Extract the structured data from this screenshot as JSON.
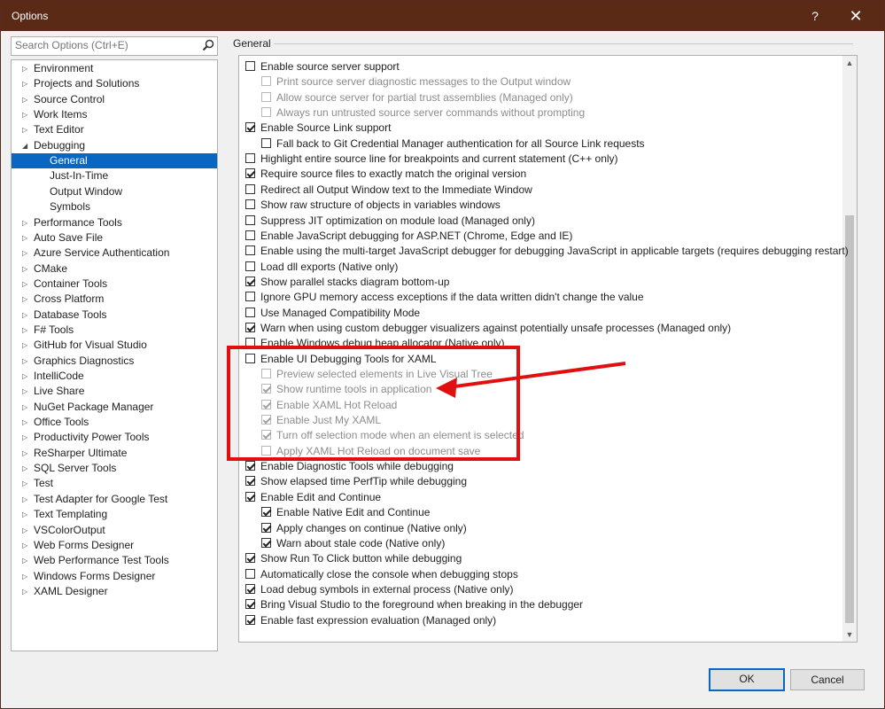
{
  "window": {
    "title": "Options",
    "help_button": "?",
    "close_button": "✕"
  },
  "search": {
    "placeholder": "Search Options (Ctrl+E)"
  },
  "tree": {
    "items": [
      {
        "label": "Environment",
        "level": 0,
        "expanded": false
      },
      {
        "label": "Projects and Solutions",
        "level": 0,
        "expanded": false
      },
      {
        "label": "Source Control",
        "level": 0,
        "expanded": false
      },
      {
        "label": "Work Items",
        "level": 0,
        "expanded": false
      },
      {
        "label": "Text Editor",
        "level": 0,
        "expanded": false
      },
      {
        "label": "Debugging",
        "level": 0,
        "expanded": true
      },
      {
        "label": "General",
        "level": 1,
        "selected": true
      },
      {
        "label": "Just-In-Time",
        "level": 1
      },
      {
        "label": "Output Window",
        "level": 1
      },
      {
        "label": "Symbols",
        "level": 1
      },
      {
        "label": "Performance Tools",
        "level": 0,
        "expanded": false
      },
      {
        "label": "Auto Save File",
        "level": 0,
        "expanded": false
      },
      {
        "label": "Azure Service Authentication",
        "level": 0,
        "expanded": false
      },
      {
        "label": "CMake",
        "level": 0,
        "expanded": false
      },
      {
        "label": "Container Tools",
        "level": 0,
        "expanded": false
      },
      {
        "label": "Cross Platform",
        "level": 0,
        "expanded": false
      },
      {
        "label": "Database Tools",
        "level": 0,
        "expanded": false
      },
      {
        "label": "F# Tools",
        "level": 0,
        "expanded": false
      },
      {
        "label": "GitHub for Visual Studio",
        "level": 0,
        "expanded": false
      },
      {
        "label": "Graphics Diagnostics",
        "level": 0,
        "expanded": false
      },
      {
        "label": "IntelliCode",
        "level": 0,
        "expanded": false
      },
      {
        "label": "Live Share",
        "level": 0,
        "expanded": false
      },
      {
        "label": "NuGet Package Manager",
        "level": 0,
        "expanded": false
      },
      {
        "label": "Office Tools",
        "level": 0,
        "expanded": false
      },
      {
        "label": "Productivity Power Tools",
        "level": 0,
        "expanded": false
      },
      {
        "label": "ReSharper Ultimate",
        "level": 0,
        "expanded": false
      },
      {
        "label": "SQL Server Tools",
        "level": 0,
        "expanded": false
      },
      {
        "label": "Test",
        "level": 0,
        "expanded": false
      },
      {
        "label": "Test Adapter for Google Test",
        "level": 0,
        "expanded": false
      },
      {
        "label": "Text Templating",
        "level": 0,
        "expanded": false
      },
      {
        "label": "VSColorOutput",
        "level": 0,
        "expanded": false
      },
      {
        "label": "Web Forms Designer",
        "level": 0,
        "expanded": false
      },
      {
        "label": "Web Performance Test Tools",
        "level": 0,
        "expanded": false
      },
      {
        "label": "Windows Forms Designer",
        "level": 0,
        "expanded": false
      },
      {
        "label": "XAML Designer",
        "level": 0,
        "expanded": false
      }
    ]
  },
  "section": {
    "title": "General"
  },
  "options": [
    {
      "label": "Enable source server support",
      "indent": 0,
      "checked": false,
      "enabled": true
    },
    {
      "label": "Print source server diagnostic messages to the Output window",
      "indent": 1,
      "checked": false,
      "enabled": false
    },
    {
      "label": "Allow source server for partial trust assemblies (Managed only)",
      "indent": 1,
      "checked": false,
      "enabled": false
    },
    {
      "label": "Always run untrusted source server commands without prompting",
      "indent": 1,
      "checked": false,
      "enabled": false
    },
    {
      "label": "Enable Source Link support",
      "indent": 0,
      "checked": true,
      "enabled": true
    },
    {
      "label": "Fall back to Git Credential Manager authentication for all Source Link requests",
      "indent": 1,
      "checked": false,
      "enabled": true
    },
    {
      "label": "Highlight entire source line for breakpoints and current statement (C++ only)",
      "indent": 0,
      "checked": false,
      "enabled": true
    },
    {
      "label": "Require source files to exactly match the original version",
      "indent": 0,
      "checked": true,
      "enabled": true
    },
    {
      "label": "Redirect all Output Window text to the Immediate Window",
      "indent": 0,
      "checked": false,
      "enabled": true
    },
    {
      "label": "Show raw structure of objects in variables windows",
      "indent": 0,
      "checked": false,
      "enabled": true
    },
    {
      "label": "Suppress JIT optimization on module load (Managed only)",
      "indent": 0,
      "checked": false,
      "enabled": true
    },
    {
      "label": "Enable JavaScript debugging for ASP.NET (Chrome, Edge and IE)",
      "indent": 0,
      "checked": false,
      "enabled": true
    },
    {
      "label": "Enable using the multi-target JavaScript debugger for debugging JavaScript in applicable targets (requires debugging restart)",
      "indent": 0,
      "checked": false,
      "enabled": true
    },
    {
      "label": "Load dll exports (Native only)",
      "indent": 0,
      "checked": false,
      "enabled": true
    },
    {
      "label": "Show parallel stacks diagram bottom-up",
      "indent": 0,
      "checked": true,
      "enabled": true
    },
    {
      "label": "Ignore GPU memory access exceptions if the data written didn't change the value",
      "indent": 0,
      "checked": false,
      "enabled": true
    },
    {
      "label": "Use Managed Compatibility Mode",
      "indent": 0,
      "checked": false,
      "enabled": true
    },
    {
      "label": "Warn when using custom debugger visualizers against potentially unsafe processes (Managed only)",
      "indent": 0,
      "checked": true,
      "enabled": true
    },
    {
      "label": "Enable Windows debug heap allocator (Native only)",
      "indent": 0,
      "checked": false,
      "enabled": true
    },
    {
      "label": "Enable UI Debugging Tools for XAML",
      "indent": 0,
      "checked": false,
      "enabled": true
    },
    {
      "label": "Preview selected elements in Live Visual Tree",
      "indent": 1,
      "checked": false,
      "enabled": false
    },
    {
      "label": "Show runtime tools in application",
      "indent": 1,
      "checked": true,
      "enabled": false
    },
    {
      "label": "Enable XAML Hot Reload",
      "indent": 1,
      "checked": true,
      "enabled": false
    },
    {
      "label": "Enable Just My XAML",
      "indent": 1,
      "checked": true,
      "enabled": false
    },
    {
      "label": "Turn off selection mode when an element is selected",
      "indent": 1,
      "checked": true,
      "enabled": false
    },
    {
      "label": "Apply XAML Hot Reload on document save",
      "indent": 1,
      "checked": false,
      "enabled": false
    },
    {
      "label": "Enable Diagnostic Tools while debugging",
      "indent": 0,
      "checked": true,
      "enabled": true
    },
    {
      "label": "Show elapsed time PerfTip while debugging",
      "indent": 0,
      "checked": true,
      "enabled": true
    },
    {
      "label": "Enable Edit and Continue",
      "indent": 0,
      "checked": true,
      "enabled": true
    },
    {
      "label": "Enable Native Edit and Continue",
      "indent": 1,
      "checked": true,
      "enabled": true
    },
    {
      "label": "Apply changes on continue (Native only)",
      "indent": 1,
      "checked": true,
      "enabled": true
    },
    {
      "label": "Warn about stale code (Native only)",
      "indent": 1,
      "checked": true,
      "enabled": true
    },
    {
      "label": "Show Run To Click button while debugging",
      "indent": 0,
      "checked": true,
      "enabled": true
    },
    {
      "label": "Automatically close the console when debugging stops",
      "indent": 0,
      "checked": false,
      "enabled": true
    },
    {
      "label": "Load debug symbols in external process (Native only)",
      "indent": 0,
      "checked": true,
      "enabled": true
    },
    {
      "label": "Bring Visual Studio to the foreground when breaking in the debugger",
      "indent": 0,
      "checked": true,
      "enabled": true
    },
    {
      "label": "Enable fast expression evaluation (Managed only)",
      "indent": 0,
      "checked": true,
      "enabled": true
    }
  ],
  "buttons": {
    "ok": "OK",
    "cancel": "Cancel"
  },
  "colors": {
    "title_bar": "#5a2a17",
    "selection": "#0a67c1",
    "annotation": "#e01010"
  }
}
